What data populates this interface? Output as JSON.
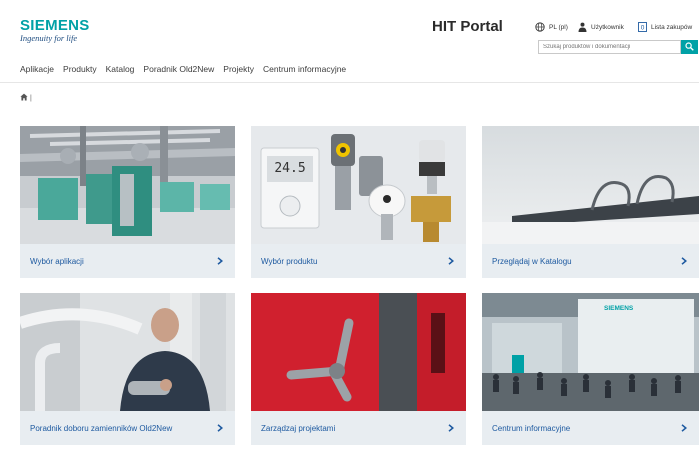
{
  "brand": {
    "name": "SIEMENS",
    "tagline": "Ingenuity for life",
    "color": "#00a1a6"
  },
  "header": {
    "title": "HIT Portal",
    "language": "PL (pl)",
    "user": "Użytkownik",
    "list": "Lista zakupów",
    "search_placeholder": "Szukaj produktów i dokumentacji"
  },
  "nav": {
    "items": [
      {
        "label": "Aplikacje"
      },
      {
        "label": "Produkty"
      },
      {
        "label": "Katalog"
      },
      {
        "label": "Poradnik Old2New"
      },
      {
        "label": "Projekty"
      },
      {
        "label": "Centrum informacyjne"
      }
    ]
  },
  "breadcrumb": {
    "separator": "|"
  },
  "tiles": [
    {
      "label": "Wybór aplikacji",
      "icon": "chevron-right-icon"
    },
    {
      "label": "Wybór produktu",
      "icon": "chevron-right-icon"
    },
    {
      "label": "Przeglądaj w Katalogu",
      "icon": "chevron-right-icon"
    },
    {
      "label": "Poradnik doboru zamienników Old2New",
      "icon": "chevron-right-icon"
    },
    {
      "label": "Zarządzaj projektami",
      "icon": "chevron-right-icon"
    },
    {
      "label": "Centrum informacyjne",
      "icon": "chevron-right-icon"
    }
  ],
  "thermostat": {
    "reading": "24.5"
  },
  "colors": {
    "accent": "#00a1a6",
    "link": "#1e5aa0",
    "tile_bar": "#e8edf1"
  }
}
